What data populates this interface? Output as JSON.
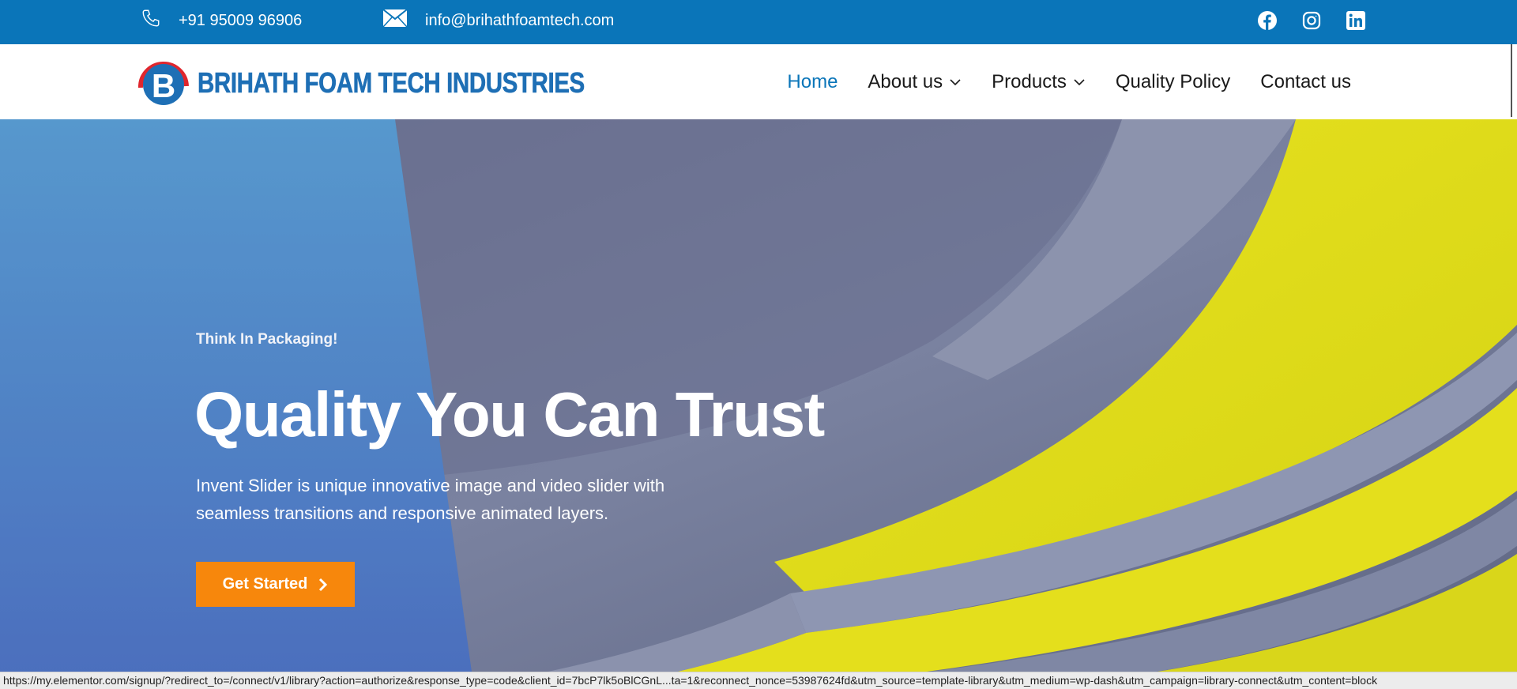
{
  "topbar": {
    "phone": "+91 95009 96906",
    "email": "info@brihathfoamtech.com",
    "phone_icon": "phone-icon",
    "email_icon": "envelope-icon",
    "socials": [
      "facebook-icon",
      "instagram-icon",
      "linkedin-icon"
    ],
    "color": "#0a75b9"
  },
  "header": {
    "logo_text": "BRIHATH FOAM TECH INDUSTRIES",
    "logo_colors": {
      "ring": "#e0262d",
      "letter": "#1e6fb5"
    },
    "nav": [
      {
        "label": "Home",
        "active": true,
        "dropdown": false
      },
      {
        "label": "About us",
        "active": false,
        "dropdown": true
      },
      {
        "label": "Products",
        "active": false,
        "dropdown": true
      },
      {
        "label": "Quality Policy",
        "active": false,
        "dropdown": false
      },
      {
        "label": "Contact us",
        "active": false,
        "dropdown": false
      }
    ]
  },
  "hero": {
    "eyebrow": "Think In Packaging!",
    "headline": "Quality You Can Trust",
    "description": "Invent Slider is unique innovative image and video slider with seamless transitions and responsive animated layers.",
    "cta_label": "Get Started",
    "cta_color": "#f7870c",
    "overlay_color": "#4a7fc6"
  },
  "status_bar": {
    "url": "https://my.elementor.com/signup/?redirect_to=/connect/v1/library?action=authorize&response_type=code&client_id=7bcP7lk5oBlCGnL...ta=1&reconnect_nonce=53987624fd&utm_source=template-library&utm_medium=wp-dash&utm_campaign=library-connect&utm_content=block"
  }
}
